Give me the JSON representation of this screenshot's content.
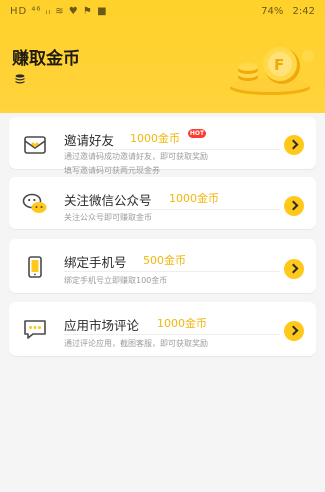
{
  "status_bar": {
    "left": "HD ⁴⁶ ᵢₗ ≋ ♥ ⚑ ■",
    "battery": "74%",
    "time": "2:42"
  },
  "header": {
    "title": "赚取金币"
  },
  "tasks": [
    {
      "title": "邀请好友",
      "reward": "1000金币",
      "badge": "HOT",
      "desc_line1": "通过邀请码成功邀请好友，即可获取奖励",
      "desc_line2": "填写邀请码可获两元现金券"
    },
    {
      "title": "关注微信公众号",
      "reward": "1000金币",
      "desc_line1": "关注公众号即可赚取金币"
    },
    {
      "title": "绑定手机号",
      "reward": "500金币",
      "desc_line1": "绑定手机号立即赚取100金币"
    },
    {
      "title": "应用市场评论",
      "reward": "1000金币",
      "desc_line1": "通过评论应用，截图客服，即可获取奖励"
    }
  ]
}
